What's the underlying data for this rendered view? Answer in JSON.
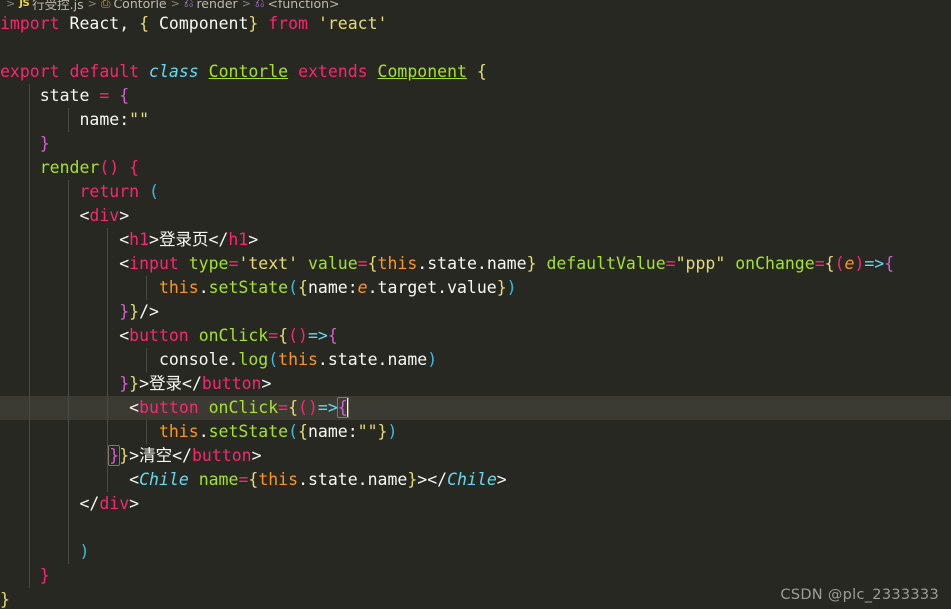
{
  "breadcrumb": {
    "items": [
      {
        "icon": "js-file-icon",
        "label": "行受控.js"
      },
      {
        "icon": "class-symbol-icon",
        "label": "Contorle"
      },
      {
        "icon": "method-symbol-icon",
        "label": "render"
      },
      {
        "icon": "method-symbol-icon",
        "label": "<function>"
      }
    ],
    "separator": ">"
  },
  "editor": {
    "language": "javascript",
    "theme": "Monokai",
    "background_color": "#272822",
    "current_line_color": "#3b3b33",
    "caret_color": "#f8f8f0",
    "lines": [
      "import React, { Component} from 'react'",
      "",
      "export default class Contorle extends Component {",
      "    state = {",
      "        name:\"\"",
      "    }",
      "    render() {",
      "        return (",
      "        <div>",
      "            <h1>登录页</h1>",
      "            <input type='text' value={this.state.name} defaultValue=\"ppp\" onChange={(e)=>{",
      "                this.setState({name:e.target.value})",
      "            }}/>",
      "            <button onClick={()=>{",
      "                console.log(this.state.name)",
      "            }}>登录</button>",
      "             <button onClick={()=>{",
      "                this.setState({name:\"\"})",
      "            }}>清空</button>",
      "             <Chile name={this.state.name}></Chile>",
      "        </div>",
      "",
      "        )",
      "    }",
      "}"
    ],
    "current_line_number": 17,
    "current_line_text": "             <button onClick={()=>{"
  },
  "tokens": {
    "l1": {
      "import": "import",
      "react_ident": "React,",
      "lbrace": "{",
      "component": " Component",
      "rbrace": "}",
      "from": "from",
      "module": "'react'"
    },
    "l3": {
      "export": "export",
      "default": "default",
      "class": "class",
      "name": "Contorle",
      "extends": "extends",
      "base": "Component",
      "lbrace": "{"
    },
    "l4": {
      "state": "state",
      "eq": "=",
      "lbrace": "{"
    },
    "l5": {
      "key": "name",
      "colon": ":",
      "value": "\"\""
    },
    "l6": {
      "rbrace": "}"
    },
    "l7": {
      "render": "render",
      "parens": "()",
      "lbrace": "{"
    },
    "l8": {
      "return": "return",
      "lparen": "("
    },
    "l9": {
      "open": "<div>"
    },
    "l10": {
      "open": "<h1>",
      "text": "登录页",
      "close": "</h1>"
    },
    "l11": {
      "tag": "input",
      "attr_type": "type",
      "val_type": "'text'",
      "attr_value": "value",
      "expr_value": "this.state.name",
      "attr_default": "defaultValue",
      "val_default": "\"ppp\"",
      "attr_change": "onChange",
      "param": "e",
      "arrow": "=>"
    },
    "l12": {
      "this": "this",
      "method": "setState",
      "key": "name",
      "param": "e",
      "props": "target.value"
    },
    "l13": {
      "close": "}}/>"
    },
    "l14": {
      "tag": "button",
      "attr": "onClick",
      "arrow": "=>"
    },
    "l15": {
      "console": "console",
      "log": "log",
      "arg": "this.state.name"
    },
    "l16": {
      "close": "}}>",
      "text": "登录",
      "closetag": "</button>"
    },
    "l17": {
      "tag": "button",
      "attr": "onClick",
      "arrow": "=>"
    },
    "l18": {
      "this": "this",
      "method": "setState",
      "key": "name",
      "value": "\"\""
    },
    "l19": {
      "close": "}}>",
      "text": "清空",
      "closetag": "</button>"
    },
    "l20": {
      "comp_open": "Chile",
      "attr": "name",
      "expr": "this.state.name",
      "comp_close": "Chile"
    },
    "l21": {
      "close": "</div>"
    },
    "l23": {
      "rparen": ")"
    },
    "l24": {
      "rbrace": "}"
    },
    "l25": {
      "rbrace": "}"
    }
  },
  "watermark": {
    "text": "CSDN @plc_2333333"
  }
}
